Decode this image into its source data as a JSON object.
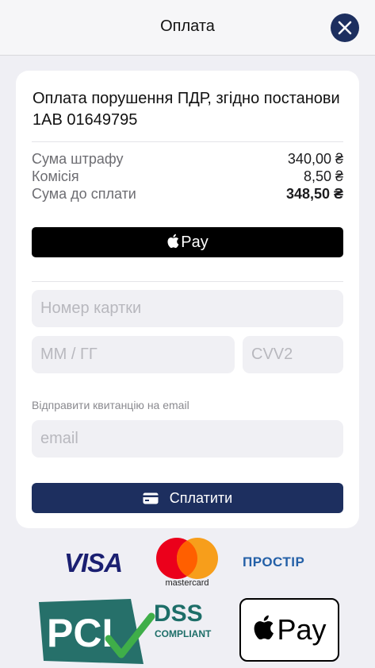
{
  "header": {
    "title": "Оплата"
  },
  "payment": {
    "title": "Оплата порушення ПДР, згідно постанови 1АВ 01649795",
    "rows": [
      {
        "label": "Сума штрафу",
        "value": "340,00 ₴"
      },
      {
        "label": "Комісія",
        "value": "8,50 ₴"
      },
      {
        "label": "Сума до сплати",
        "value": "348,50 ₴"
      }
    ]
  },
  "apple_pay_button": {
    "label": "Pay"
  },
  "form": {
    "card_number_placeholder": "Номер картки",
    "expiry_placeholder": "ММ / ГГ",
    "cvv_placeholder": "CVV2",
    "email_label": "Відправити квитанцію на email",
    "email_placeholder": "email"
  },
  "pay_button": {
    "label": "Сплатити"
  },
  "logos": {
    "visa": "VISA",
    "mastercard": "mastercard",
    "prostir": "ПРОСТІР",
    "pci_dss": "DSS",
    "pci_compliant": "COMPLIANT",
    "apple_pay": "Pay"
  },
  "colors": {
    "accent": "#1d2f5f",
    "background": "#efeff4"
  }
}
